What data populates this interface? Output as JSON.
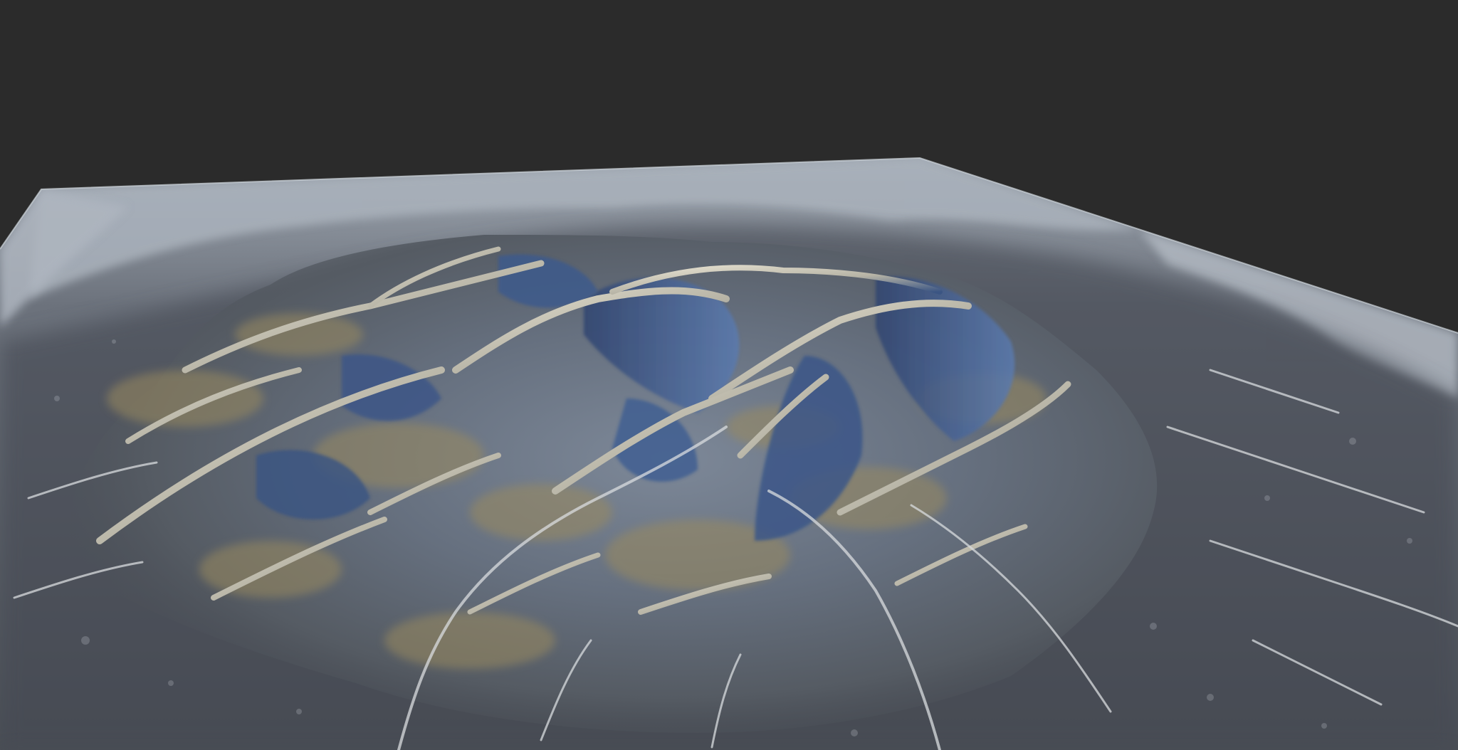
{
  "viewport": {
    "background_color": "#2b2b2b",
    "scene": "3d-terrain-render"
  },
  "terrain": {
    "base_color": "#5b6068",
    "edge_color": "#b9c0c8",
    "ridge_highlight_color": "#e4e0d2",
    "shadow_color": "#31466b",
    "ochre_color": "#9a8a5e",
    "snow_color": "#c7ccd3"
  }
}
